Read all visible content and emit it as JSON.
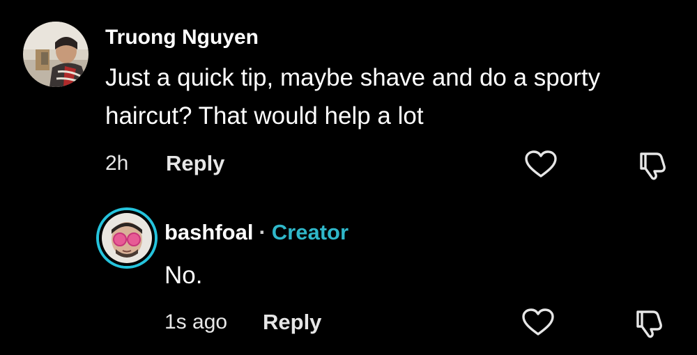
{
  "comments": [
    {
      "username": "Truong Nguyen",
      "text": "Just a quick tip, maybe shave and do a sporty haircut? That would help a lot",
      "time": "2h",
      "reply_label": "Reply",
      "avatar_icon": "user-photo-avatar",
      "like_icon": "heart-outline-icon",
      "dislike_icon": "thumbs-down-outline-icon"
    },
    {
      "username": "bashfoal",
      "separator": "·",
      "badge": "Creator",
      "text": "No.",
      "time": "1s ago",
      "reply_label": "Reply",
      "avatar_icon": "creator-photo-avatar",
      "like_icon": "heart-outline-icon",
      "dislike_icon": "thumbs-down-outline-icon"
    }
  ],
  "colors": {
    "background": "#000000",
    "text": "#ffffff",
    "secondary_text": "#e6e6e6",
    "creator_badge": "#2fb7c9",
    "avatar_ring": "#25c4dd"
  }
}
